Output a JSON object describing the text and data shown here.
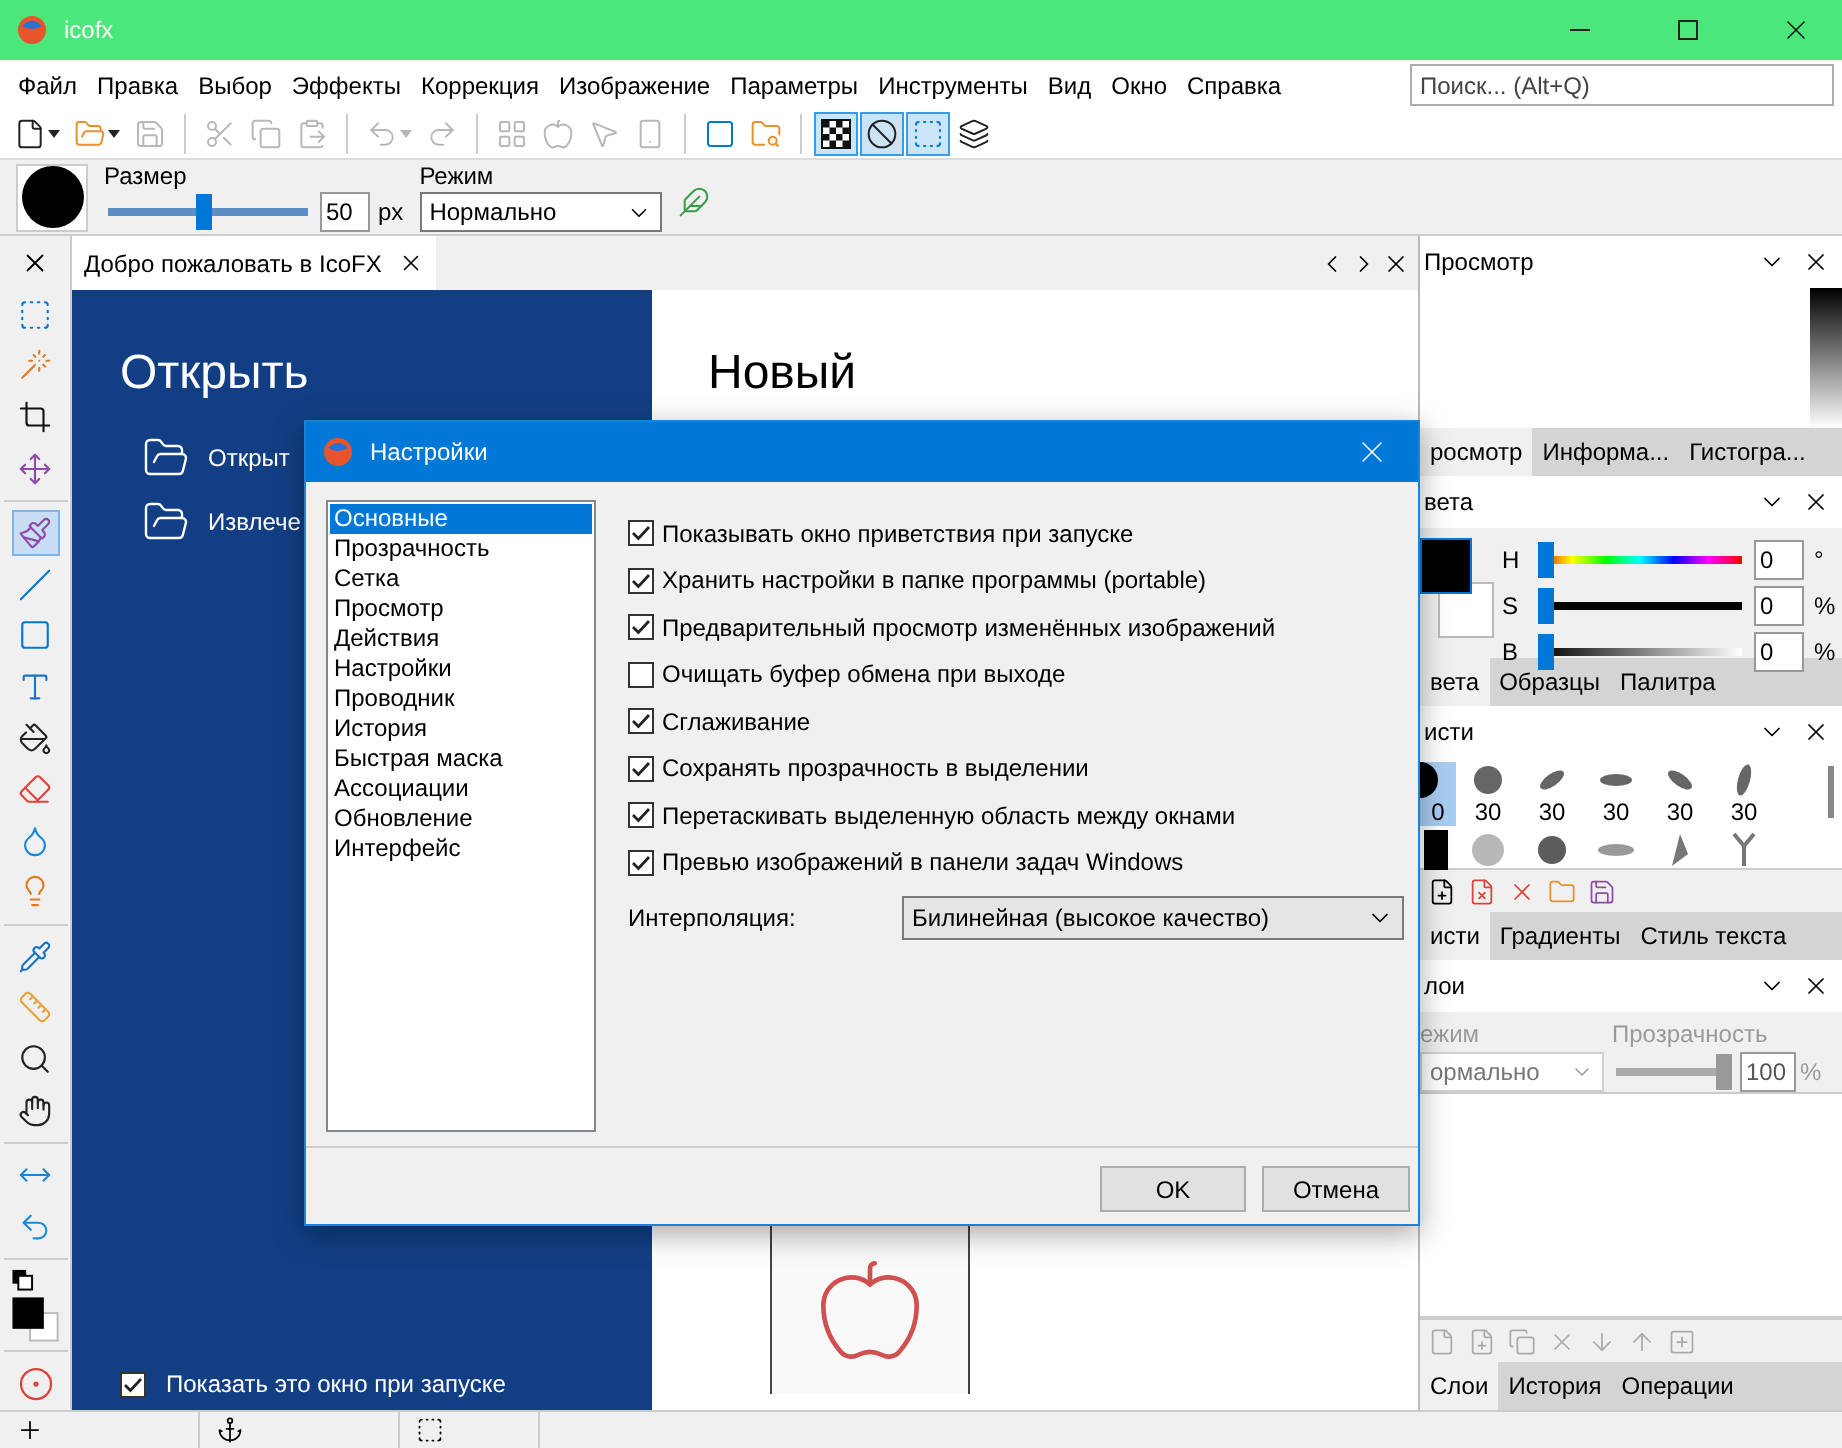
{
  "window": {
    "title": "icofx"
  },
  "menu": [
    "Файл",
    "Правка",
    "Выбор",
    "Эффекты",
    "Коррекция",
    "Изображение",
    "Параметры",
    "Инструменты",
    "Вид",
    "Окно",
    "Справка"
  ],
  "search": {
    "placeholder": "Поиск... (Alt+Q)"
  },
  "toolbar": [
    {
      "disabled": false,
      "on": false
    },
    {
      "disabled": false,
      "on": false
    },
    {
      "disabled": true,
      "on": false
    },
    {
      "disabled": true,
      "on": false
    },
    {
      "disabled": true,
      "on": false
    },
    {
      "disabled": true,
      "on": false
    },
    {
      "disabled": true,
      "on": false
    },
    {
      "disabled": true,
      "on": false
    },
    {
      "disabled": true,
      "on": false
    },
    {
      "disabled": true,
      "on": false
    },
    {
      "disabled": true,
      "on": false
    },
    {
      "disabled": true,
      "on": false
    },
    {
      "disabled": false,
      "on": false
    },
    {
      "disabled": false,
      "on": false
    },
    {
      "disabled": false,
      "on": true
    },
    {
      "disabled": false,
      "on": true
    },
    {
      "disabled": false,
      "on": true
    },
    {
      "disabled": false,
      "on": false
    }
  ],
  "options": {
    "size": {
      "label": "Размер",
      "level": 0.48,
      "value": "50",
      "unit": "px"
    },
    "mode": {
      "label": "Режим",
      "value": "Нормально"
    }
  },
  "tools": [
    {
      "selected": false
    },
    {
      "selected": false
    },
    {
      "selected": false
    },
    {
      "selected": false
    },
    {
      "selected": true
    },
    {
      "selected": false
    },
    {
      "selected": false
    },
    {
      "selected": false
    },
    {
      "selected": false
    },
    {
      "selected": false
    },
    {
      "selected": false
    },
    {
      "selected": false
    },
    {
      "selected": false
    },
    {
      "selected": false
    },
    {
      "selected": false
    },
    {
      "selected": false
    },
    {
      "selected": false
    },
    {
      "selected": false
    }
  ],
  "document_tab": {
    "title": "Добро пожаловать в IcoFX"
  },
  "welcome": {
    "open_title": "Открыть",
    "open_items": [
      "Открыт",
      "Извлече"
    ],
    "new_title": "Новый",
    "show_on_start": {
      "label": "Показать это окно при запуске",
      "checked": true
    }
  },
  "panels": [
    {
      "kind": "preview",
      "title": "Просмотр",
      "tabs": [
        {
          "label": "росмотр",
          "selected": true
        },
        {
          "label": "Информа...",
          "selected": false
        },
        {
          "label": "Гистогра...",
          "selected": false
        }
      ]
    },
    {
      "kind": "colors",
      "title": "вета",
      "channels": [
        {
          "name": "H",
          "value": "0",
          "unit": "°",
          "level": 0
        },
        {
          "name": "S",
          "value": "0",
          "unit": "%",
          "level": 0
        },
        {
          "name": "B",
          "value": "0",
          "unit": "%",
          "level": 0
        }
      ],
      "tabs": [
        {
          "label": "вета",
          "selected": true
        },
        {
          "label": "Образцы",
          "selected": false
        },
        {
          "label": "Палитра",
          "selected": false
        }
      ]
    },
    {
      "kind": "brushes",
      "title": "исти",
      "brushes": [
        {
          "label": "0",
          "selected": true
        },
        {
          "label": "30",
          "selected": false
        },
        {
          "label": "30",
          "selected": false
        },
        {
          "label": "30",
          "selected": false
        },
        {
          "label": "30",
          "selected": false
        },
        {
          "label": "30",
          "selected": false
        }
      ],
      "tabs": [
        {
          "label": "исти",
          "selected": true
        },
        {
          "label": "Градиенты",
          "selected": false
        },
        {
          "label": "Стиль текста",
          "selected": false
        }
      ]
    },
    {
      "kind": "layers",
      "title": "лои",
      "mode_label": "ежим",
      "mode_value": "ормально",
      "opacity": {
        "label": "Прозрачность",
        "level": 1,
        "value": "100",
        "unit": "%"
      },
      "tabs": [
        {
          "label": "Слои",
          "selected": true
        },
        {
          "label": "История",
          "selected": false
        },
        {
          "label": "Операции",
          "selected": false
        }
      ]
    }
  ],
  "dialog": {
    "title": "Настройки",
    "categories": [
      {
        "label": "Основные",
        "selected": true
      },
      {
        "label": "Прозрачность",
        "selected": false
      },
      {
        "label": "Сетка",
        "selected": false
      },
      {
        "label": "Просмотр",
        "selected": false
      },
      {
        "label": "Действия",
        "selected": false
      },
      {
        "label": "Настройки",
        "selected": false
      },
      {
        "label": "Проводник",
        "selected": false
      },
      {
        "label": "История",
        "selected": false
      },
      {
        "label": "Быстрая маска",
        "selected": false
      },
      {
        "label": "Ассоциации",
        "selected": false
      },
      {
        "label": "Обновление",
        "selected": false
      },
      {
        "label": "Интерфейс",
        "selected": false
      }
    ],
    "options": [
      {
        "label": "Показывать окно приветствия при запуске",
        "checked": true
      },
      {
        "label": "Хранить настройки в папке программы (portable)",
        "checked": true
      },
      {
        "label": "Предварительный просмотр изменённых изображений",
        "checked": true
      },
      {
        "label": "Очищать буфер обмена при выходе",
        "checked": false
      },
      {
        "label": "Сглаживание",
        "checked": true
      },
      {
        "label": "Сохранять прозрачность в выделении",
        "checked": true
      },
      {
        "label": "Перетаскивать выделенную область между окнами",
        "checked": true
      },
      {
        "label": "Превью изображений в панели задач Windows",
        "checked": true
      }
    ],
    "interpolation": {
      "label": "Интерполяция:",
      "value": "Билинейная (высокое качество)"
    },
    "buttons": [
      "OK",
      "Отмена"
    ]
  }
}
